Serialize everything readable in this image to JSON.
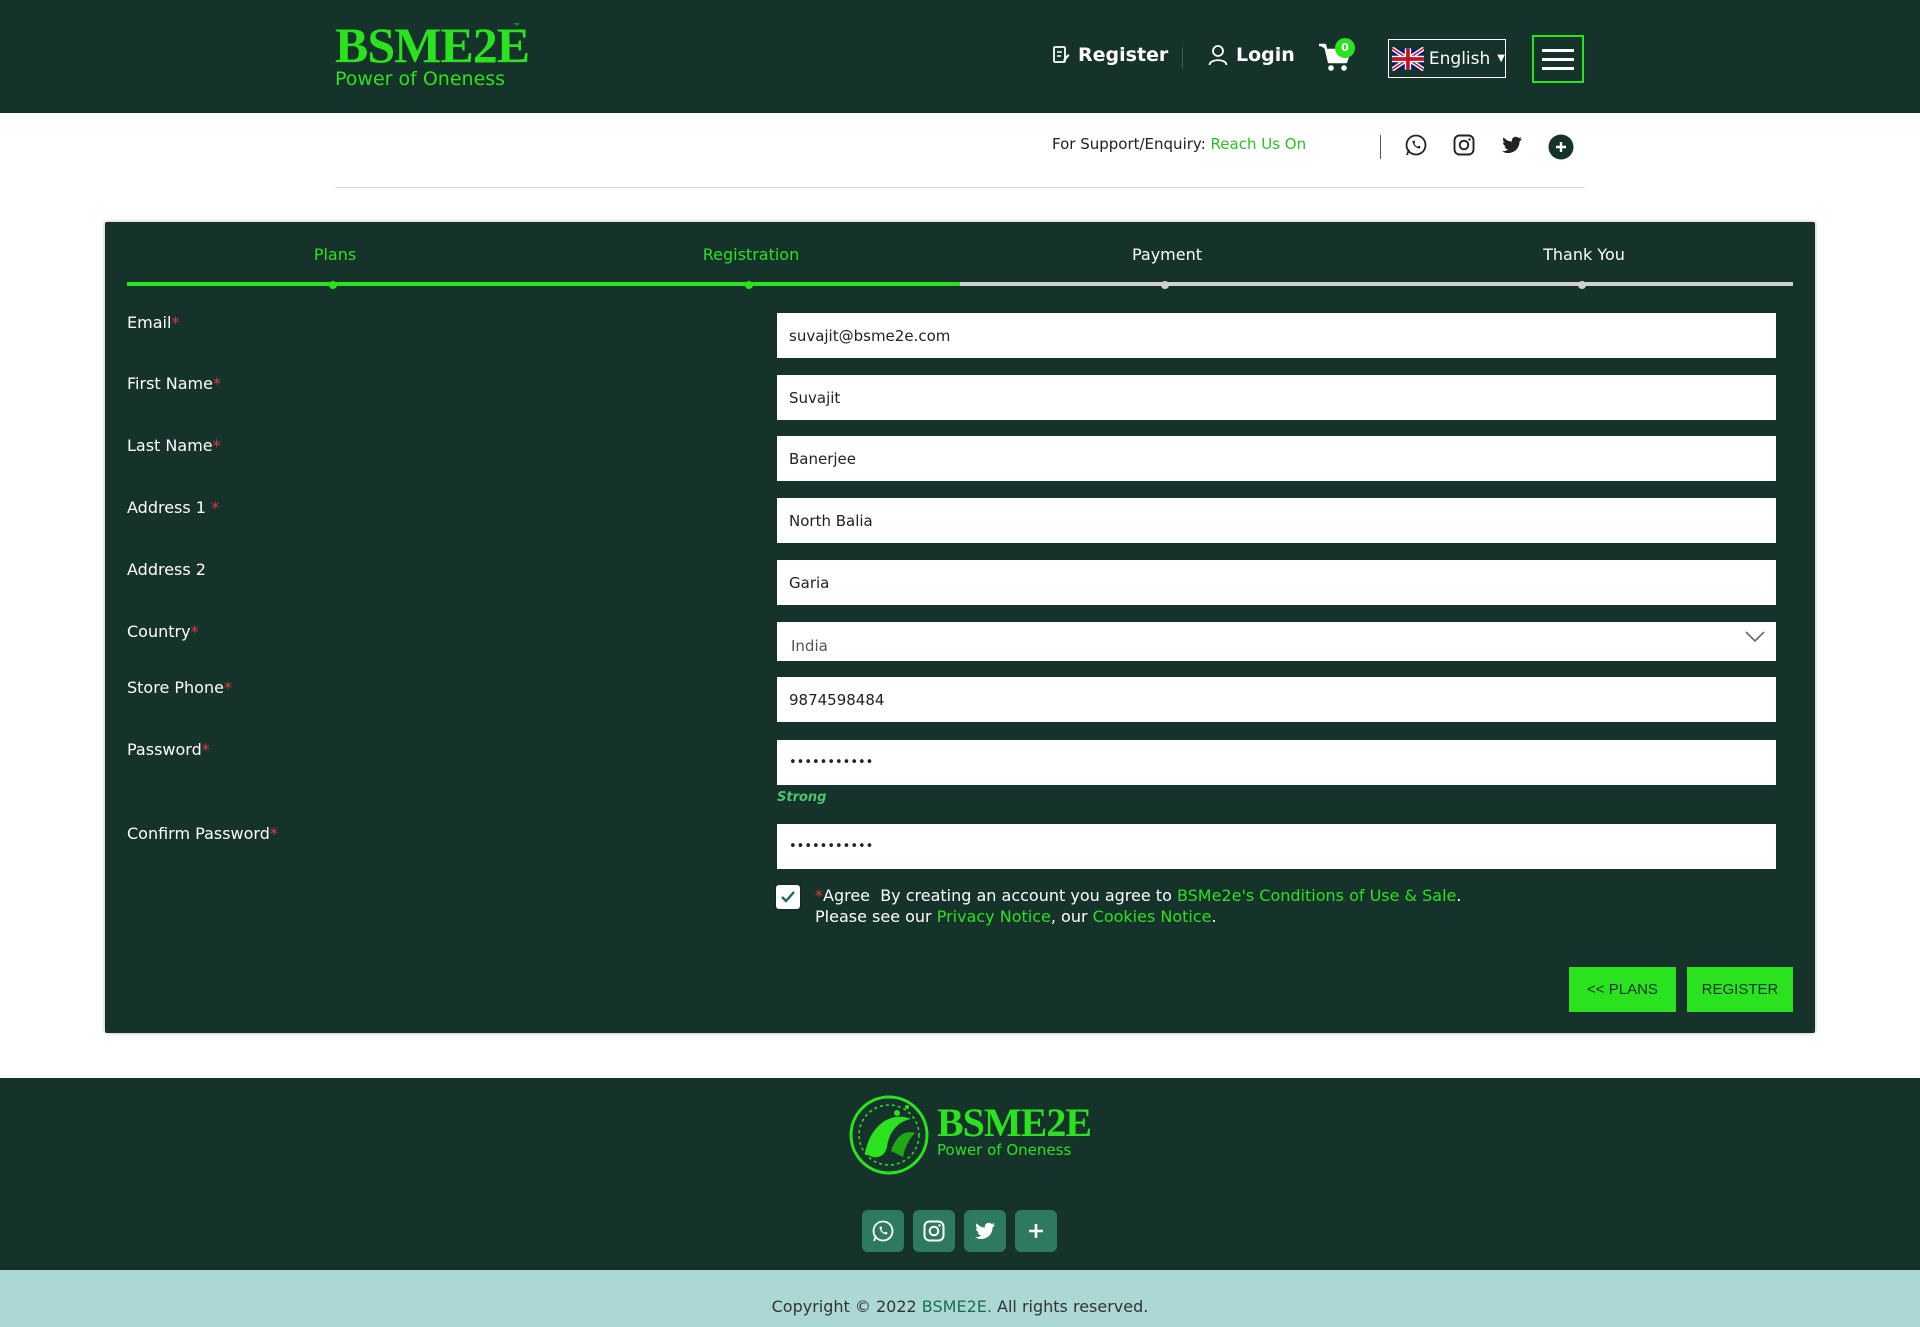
{
  "header": {
    "logo_main": "BSME2E",
    "logo_tm": "™",
    "logo_sub": "Power of Oneness",
    "register_label": "Register",
    "login_label": "Login",
    "cart_count": "0",
    "language": "English"
  },
  "support": {
    "prefix": "For Support/Enquiry:",
    "link": "Reach Us On"
  },
  "steps": [
    {
      "label": "Plans",
      "state": "done"
    },
    {
      "label": "Registration",
      "state": "active"
    },
    {
      "label": "Payment",
      "state": "todo"
    },
    {
      "label": "Thank You",
      "state": "todo"
    }
  ],
  "form": {
    "email_label": "Email",
    "email_value": "suvajit@bsme2e.com",
    "first_name_label": "First Name",
    "first_name_value": "Suvajit",
    "last_name_label": "Last Name",
    "last_name_value": "Banerjee",
    "address1_label": "Address 1",
    "address1_value": "North Balia",
    "address2_label": "Address 2",
    "address2_value": "Garia",
    "country_label": "Country",
    "country_value": "India",
    "phone_label": "Store Phone",
    "phone_value": "9874598484",
    "password_label": "Password",
    "password_value": "•••••••••••",
    "password_strength": "Strong",
    "confirm_label": "Confirm Password",
    "confirm_value": "•••••••••••",
    "required_mark": "*",
    "agree_checked": true,
    "agree_word": "Agree",
    "agree_text1": "By creating an account you agree to",
    "agree_link1": "BSMe2e's Conditions of Use & Sale",
    "agree_text2": "Please see our",
    "agree_link2": "Privacy Notice",
    "agree_text3": ", our",
    "agree_link3": "Cookies Notice",
    "period": "."
  },
  "buttons": {
    "plans": "<< PLANS",
    "register": "REGISTER"
  },
  "footer": {
    "logo_main": "BSME2E",
    "logo_sub": "Power of Oneness",
    "copyright_prefix": "Copyright © 2022",
    "copyright_brand": "BSME2E.",
    "copyright_suffix": "All rights reserved."
  },
  "colors": {
    "brand_dark": "#16332b",
    "accent_green": "#2be21f",
    "required_red": "#e0393e",
    "copy_bar": "#abd8d5"
  }
}
